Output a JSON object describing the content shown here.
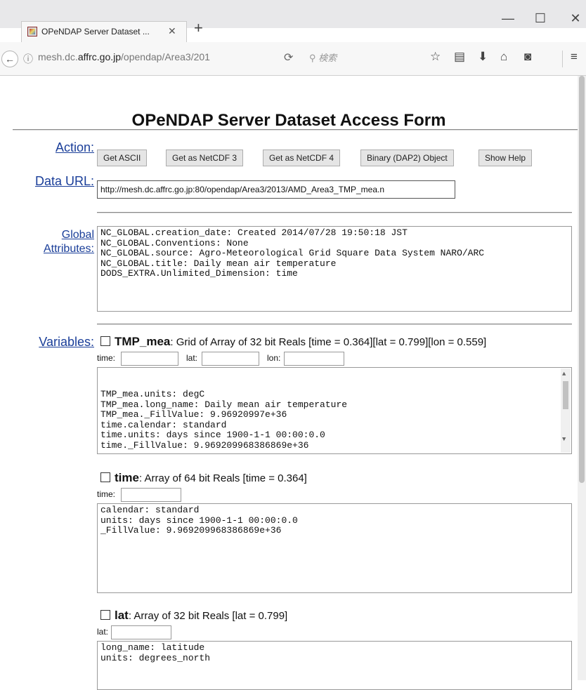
{
  "browser": {
    "tab_title": "OPeNDAP Server Dataset ...",
    "tab_close": "✕",
    "new_tab": "+",
    "window": {
      "minimize": "—",
      "maximize": "☐",
      "close": "✕"
    },
    "url_prefix": "mesh.dc.",
    "url_domain": "affrc.go.jp",
    "url_path": "/opendap/Area3/201",
    "search_placeholder": "検索",
    "icons": [
      "info-icon",
      "reload-icon",
      "search-icon",
      "star-icon",
      "reading-list-icon",
      "download-icon",
      "home-icon",
      "pocket-icon",
      "menu-icon"
    ]
  },
  "page": {
    "title": "OPeNDAP Server Dataset Access Form",
    "action_label": "Action:",
    "buttons": [
      "Get ASCII",
      "Get as NetCDF 3",
      "Get as NetCDF 4",
      "Binary (DAP2) Object",
      "Show Help"
    ],
    "data_url_label": "Data URL:",
    "data_url_value": "http://mesh.dc.affrc.go.jp:80/opendap/Area3/2013/AMD_Area3_TMP_mea.n",
    "global_label_1": "Global",
    "global_label_2": "Attributes:",
    "global_attributes": "NC_GLOBAL.creation_date: Created 2014/07/28 19:50:18 JST\nNC_GLOBAL.Conventions: None\nNC_GLOBAL.source: Agro-Meteorological Grid Square Data System NARO/ARC\nNC_GLOBAL.title: Daily mean air temperature\nDODS_EXTRA.Unlimited_Dimension: time",
    "variables_label": "Variables:",
    "variables": [
      {
        "name": "TMP_mea",
        "desc": ": Grid of Array of 32 bit Reals [time = 0.364][lat = 0.799][lon = 0.559]",
        "dims": [
          "time:",
          "lat:",
          "lon:"
        ],
        "attributes": "TMP_mea.units: degC\nTMP_mea.long_name: Daily mean air temperature\nTMP_mea._FillValue: 9.96920997e+36\ntime.calendar: standard\ntime.units: days since 1900-1-1 00:00:0.0\ntime._FillValue: 9.969209968386869e+36"
      },
      {
        "name": "time",
        "desc": ": Array of 64 bit Reals [time = 0.364]",
        "dims": [
          "time:"
        ],
        "attributes": "calendar: standard\nunits: days since 1900-1-1 00:00:0.0\n_FillValue: 9.969209968386869e+36"
      },
      {
        "name": "lat",
        "desc": ": Array of 32 bit Reals [lat = 0.799]",
        "dims": [
          "lat:"
        ],
        "attributes": "long_name: latitude\nunits: degrees_north"
      }
    ]
  }
}
